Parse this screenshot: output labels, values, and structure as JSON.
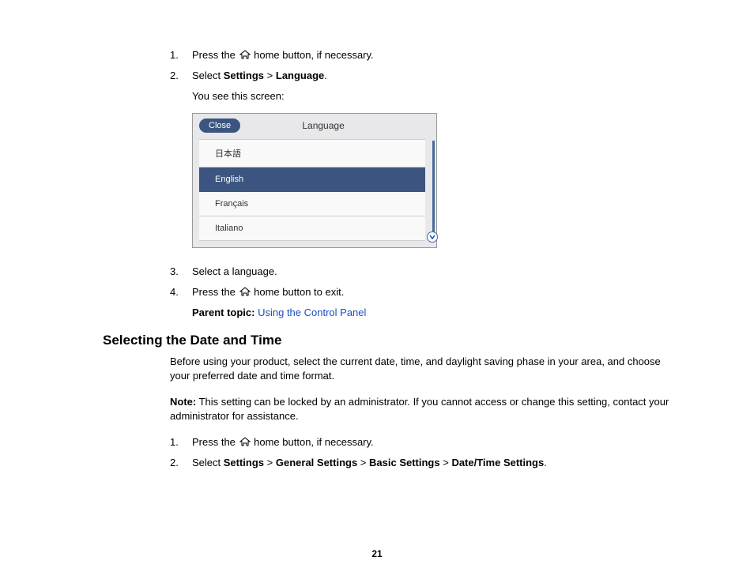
{
  "steps1": {
    "s1_pre": "Press the ",
    "s1_post": " home button, if necessary.",
    "s2_pre": "Select ",
    "s2_b1": "Settings",
    "s2_gt": " > ",
    "s2_b2": "Language",
    "s2_post": ".",
    "s2_sub": "You see this screen:",
    "s3": "Select a language.",
    "s4_pre": "Press the ",
    "s4_post": " home button to exit."
  },
  "screenshot": {
    "close": "Close",
    "title": "Language",
    "items": [
      "日本語",
      "English",
      "Français",
      "Italiano"
    ],
    "selectedIndex": 1
  },
  "parent": {
    "label": "Parent topic:",
    "link": "Using the Control Panel"
  },
  "section2": {
    "heading": "Selecting the Date and Time",
    "intro": "Before using your product, select the current date, time, and daylight saving phase in your area, and choose your preferred date and time format.",
    "note_label": "Note:",
    "note_text": " This setting can be locked by an administrator. If you cannot access or change this setting, contact your administrator for assistance.",
    "s1_pre": "Press the ",
    "s1_post": " home button, if necessary.",
    "s2_pre": "Select ",
    "s2_b1": "Settings",
    "s2_gt1": " > ",
    "s2_b2": "General Settings",
    "s2_gt2": " > ",
    "s2_b3": "Basic Settings",
    "s2_gt3": " > ",
    "s2_b4": "Date/Time Settings",
    "s2_post": "."
  },
  "pageNumber": "21"
}
